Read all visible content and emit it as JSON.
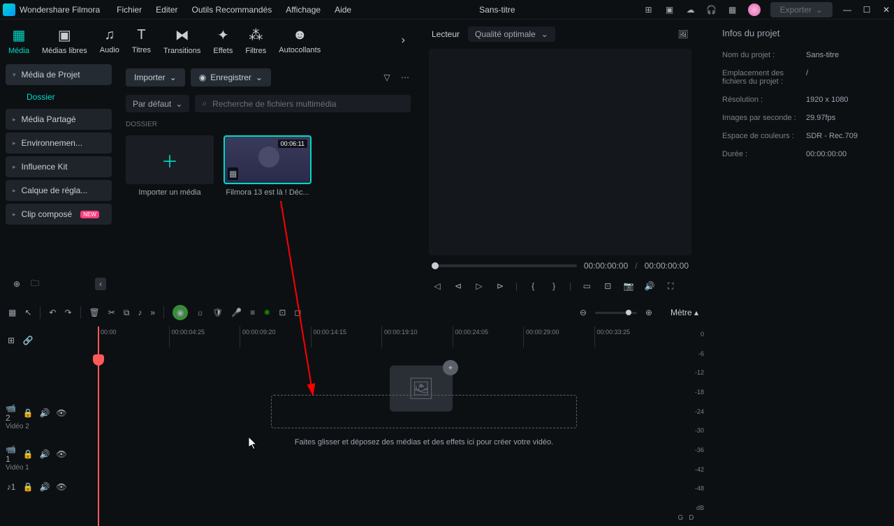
{
  "app": {
    "name": "Wondershare Filmora",
    "title": "Sans-titre",
    "export": "Exporter"
  },
  "menu": [
    "Fichier",
    "Editer",
    "Outils Recommandés",
    "Affichage",
    "Aide"
  ],
  "ribbon": [
    {
      "label": "Média",
      "icon": "▦",
      "active": true
    },
    {
      "label": "Médias libres",
      "icon": "▣"
    },
    {
      "label": "Audio",
      "icon": "♫"
    },
    {
      "label": "Titres",
      "icon": "T"
    },
    {
      "label": "Transitions",
      "icon": "⧓"
    },
    {
      "label": "Effets",
      "icon": "✦"
    },
    {
      "label": "Filtres",
      "icon": "⁂"
    },
    {
      "label": "Autocollants",
      "icon": "☻"
    }
  ],
  "sidebar": {
    "items": [
      {
        "label": "Média de Projet",
        "head": true
      },
      {
        "label": "Dossier",
        "sub": true
      },
      {
        "label": "Média Partagé"
      },
      {
        "label": "Environnemen..."
      },
      {
        "label": "Influence Kit"
      },
      {
        "label": "Calque de régla..."
      },
      {
        "label": "Clip composé",
        "badge": "NEW"
      }
    ]
  },
  "mediaPanel": {
    "importBtn": "Importer",
    "recordBtn": "Enregistrer",
    "sortBy": "Par défaut",
    "searchPlaceholder": "Recherche de fichiers multimédia",
    "sectionLabel": "DOSSIER",
    "importCard": "Importer un média",
    "clip": {
      "duration": "00:06:11",
      "name": "Filmora 13 est là ! Déc..."
    }
  },
  "preview": {
    "tab": "Lecteur",
    "quality": "Qualité optimale",
    "currentTime": "00:00:00:00",
    "totalTime": "00:00:00:00"
  },
  "info": {
    "title": "Infos du projet",
    "rows": [
      {
        "label": "Nom du projet :",
        "value": "Sans-titre"
      },
      {
        "label": "Emplacement des fichiers du projet :",
        "value": "/"
      },
      {
        "label": "Résolution :",
        "value": "1920 x 1080"
      },
      {
        "label": "Images par seconde :",
        "value": "29.97fps"
      },
      {
        "label": "Espace de couleurs :",
        "value": "SDR - Rec.709"
      },
      {
        "label": "Durée :",
        "value": "00:00:00:00"
      }
    ]
  },
  "timeline": {
    "meterLabel": "Mètre ▴",
    "ticks": [
      "00:00",
      "00:00:04:25",
      "00:00:09:20",
      "00:00:14:15",
      "00:00:19:10",
      "00:00:24:05",
      "00:00:29:00",
      "00:00:33:25"
    ],
    "tracks": {
      "v2": "Vidéo 2",
      "v1": "Vidéo 1"
    },
    "dropText": "Faites glisser et déposez des médias et des effets ici pour créer votre vidéo.",
    "meterTicks": [
      "0",
      "-6",
      "-12",
      "-18",
      "-24",
      "-30",
      "-36",
      "-42",
      "-48",
      "dB"
    ],
    "meterBottom": [
      "G",
      "D"
    ]
  }
}
